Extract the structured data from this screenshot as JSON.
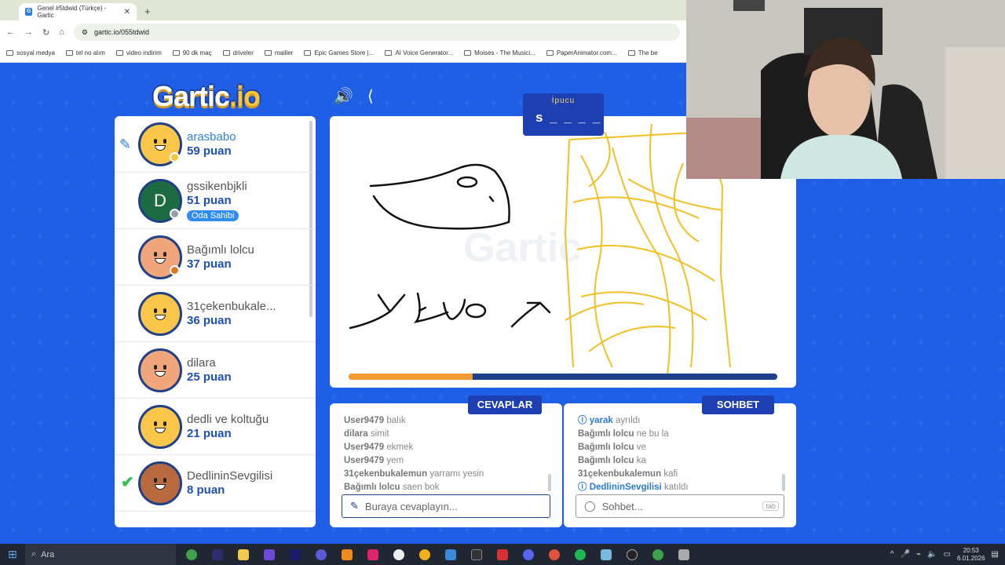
{
  "browser": {
    "tab_title": "Genel #5tdwid (Türkçe) - Gartic",
    "favicon_letter": "G",
    "url": "gartic.io/055tdwid",
    "bookmarks": [
      "sosyal medya",
      "tel no alım",
      "video indirim",
      "90 dk maç",
      "driveler",
      "mailler",
      "Epic Games Store |...",
      "AI Voice Generator...",
      "Moises - The Musici...",
      "PaperAnimator.com...",
      "The be"
    ]
  },
  "game": {
    "logo_main": "Gartic",
    "logo_suffix": ".io",
    "hint_title": "İpucu",
    "hint_word": "s _ _ _ _ _",
    "timer_progress": 0.29,
    "players": [
      {
        "name": "arasbabo",
        "score": "59 puan",
        "avatar": "yellow",
        "status": "#f5c53c",
        "drawing": true
      },
      {
        "name": "gssikenbjkli",
        "score": "51 puan",
        "avatar": "green-D",
        "letter": "D",
        "badge": "Oda Sahibi",
        "status": "#9aa0a8"
      },
      {
        "name": "Bağımlı lolcu",
        "score": "37 puan",
        "avatar": "skin",
        "status": "#e07a1f"
      },
      {
        "name": "31çekenbukale...",
        "score": "36 puan",
        "avatar": "yellow"
      },
      {
        "name": "dilara",
        "score": "25 puan",
        "avatar": "skin"
      },
      {
        "name": "dedli ve koltuğu",
        "score": "21 puan",
        "avatar": "yellow"
      },
      {
        "name": "DedlininSevgilisi",
        "score": "8 puan",
        "avatar": "dark",
        "guessed": true
      }
    ],
    "answers_tab": "CEVAPLAR",
    "chat_tab": "SOHBET",
    "answers": [
      {
        "user": "User9479",
        "text": "balık"
      },
      {
        "user": "dilara",
        "text": "simit"
      },
      {
        "user": "User9479",
        "text": "ekmek"
      },
      {
        "user": "User9479",
        "text": "yem"
      },
      {
        "user": "31çekenbukalemun",
        "text": "yarramı yesin"
      },
      {
        "user": "Bağımlı lolcu",
        "text": "saen bok"
      }
    ],
    "chat": [
      {
        "user": "yarak",
        "text": "ayrıldı",
        "system": true
      },
      {
        "user": "Bağımlı lolcu",
        "text": "ne bu la"
      },
      {
        "user": "Bağımlı lolcu",
        "text": "ve"
      },
      {
        "user": "Bağımlı lolcu",
        "text": "ka"
      },
      {
        "user": "31çekenbukalemun",
        "text": "kafi"
      },
      {
        "user": "DedlininSevgilisi",
        "text": "katıldı",
        "system": true
      }
    ],
    "answer_placeholder": "Buraya cevaplayın...",
    "chat_placeholder": "Sohbet...",
    "tab_key": "tab"
  },
  "taskbar": {
    "search_label": "Ara",
    "time": "20:53",
    "date": "6.01.2026"
  },
  "colors": {
    "accent": "#1d3fb1",
    "background": "#1f5fe6",
    "timer": "#f29a34",
    "drawing_yellow": "#f2c025"
  }
}
